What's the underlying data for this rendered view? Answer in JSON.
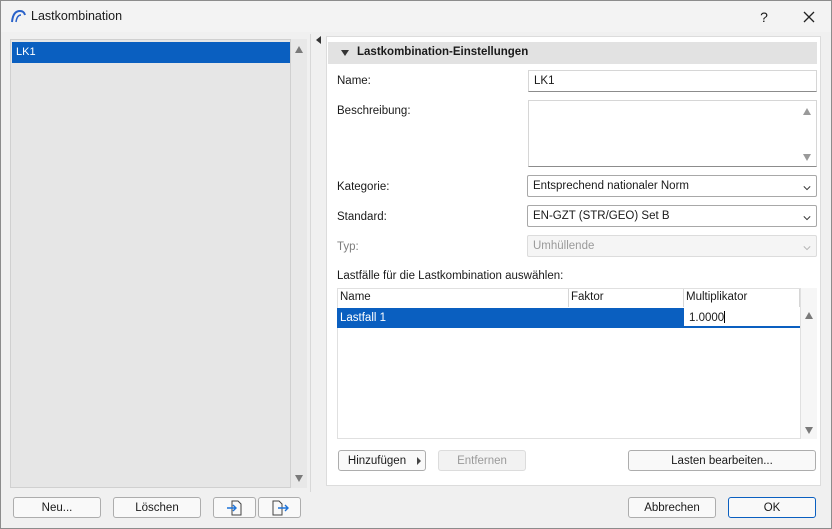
{
  "window": {
    "title": "Lastkombination",
    "help_label": "?"
  },
  "list": {
    "items": [
      {
        "label": "LK1",
        "selected": true
      }
    ]
  },
  "left_buttons": {
    "new_label": "Neu...",
    "delete_label": "Löschen",
    "import_icon": "import-icon",
    "export_icon": "export-icon"
  },
  "settings": {
    "section_title": "Lastkombination-Einstellungen",
    "name_label": "Name:",
    "name_value": "LK1",
    "description_label": "Beschreibung:",
    "description_value": "",
    "category_label": "Kategorie:",
    "category_value": "Entsprechend nationaler Norm",
    "standard_label": "Standard:",
    "standard_value": "EN-GZT (STR/GEO) Set B",
    "type_label": "Typ:",
    "type_value": "Umhüllende",
    "loadcases_label": "Lastfälle für die Lastkombination auswählen:"
  },
  "table": {
    "columns": [
      "Name",
      "Faktor",
      "Multiplikator"
    ],
    "rows": [
      {
        "name": "Lastfall 1",
        "factor": "",
        "multiplier": "1.0000",
        "selected": true
      }
    ]
  },
  "table_buttons": {
    "add_label": "Hinzufügen",
    "remove_label": "Entfernen",
    "edit_loads_label": "Lasten bearbeiten..."
  },
  "footer": {
    "cancel_label": "Abbrechen",
    "ok_label": "OK"
  },
  "colors": {
    "accent": "#0a5fc0",
    "window_bg": "#f0f0f0"
  }
}
